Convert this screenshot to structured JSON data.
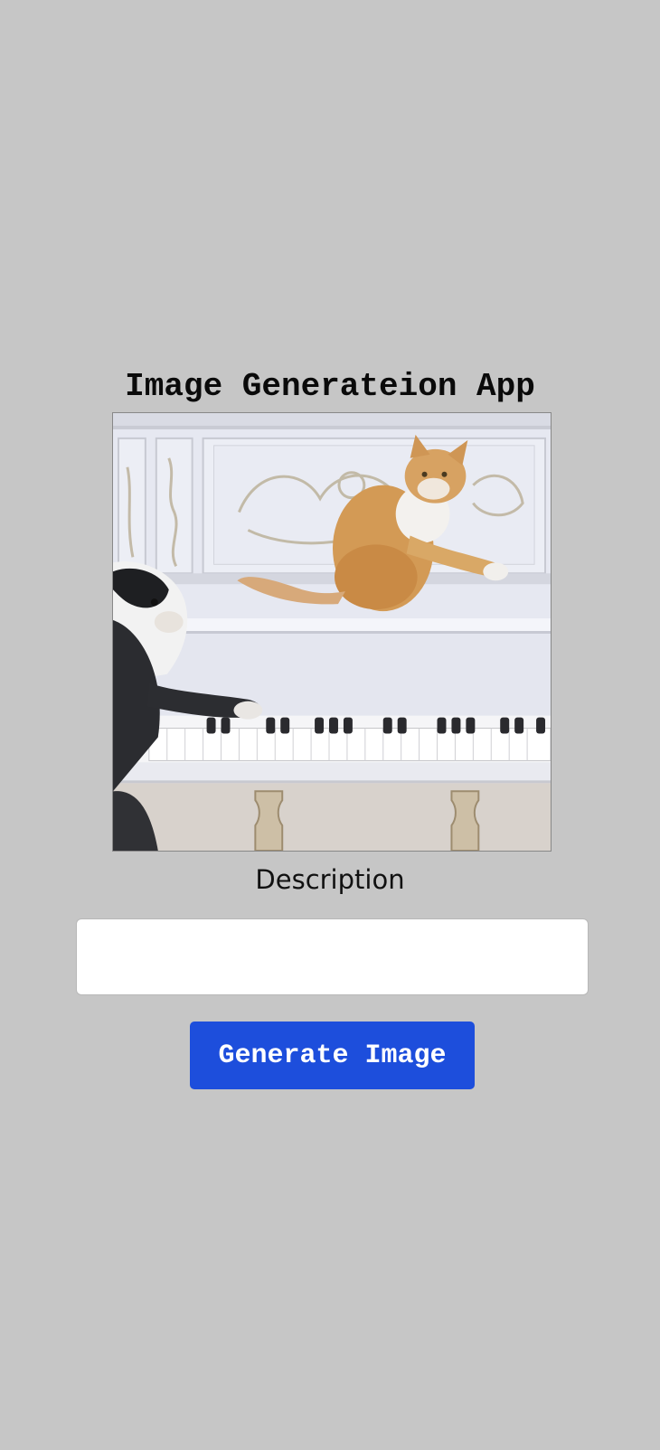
{
  "app": {
    "title": "Image Generateion App"
  },
  "image": {
    "subject": "cat-and-dog-playing-white-piano"
  },
  "form": {
    "description_label": "Description",
    "description_value": "",
    "description_placeholder": "",
    "generate_button_label": "Generate Image"
  },
  "colors": {
    "background": "#c6c6c6",
    "button": "#1d4edc",
    "button_text": "#ffffff"
  }
}
